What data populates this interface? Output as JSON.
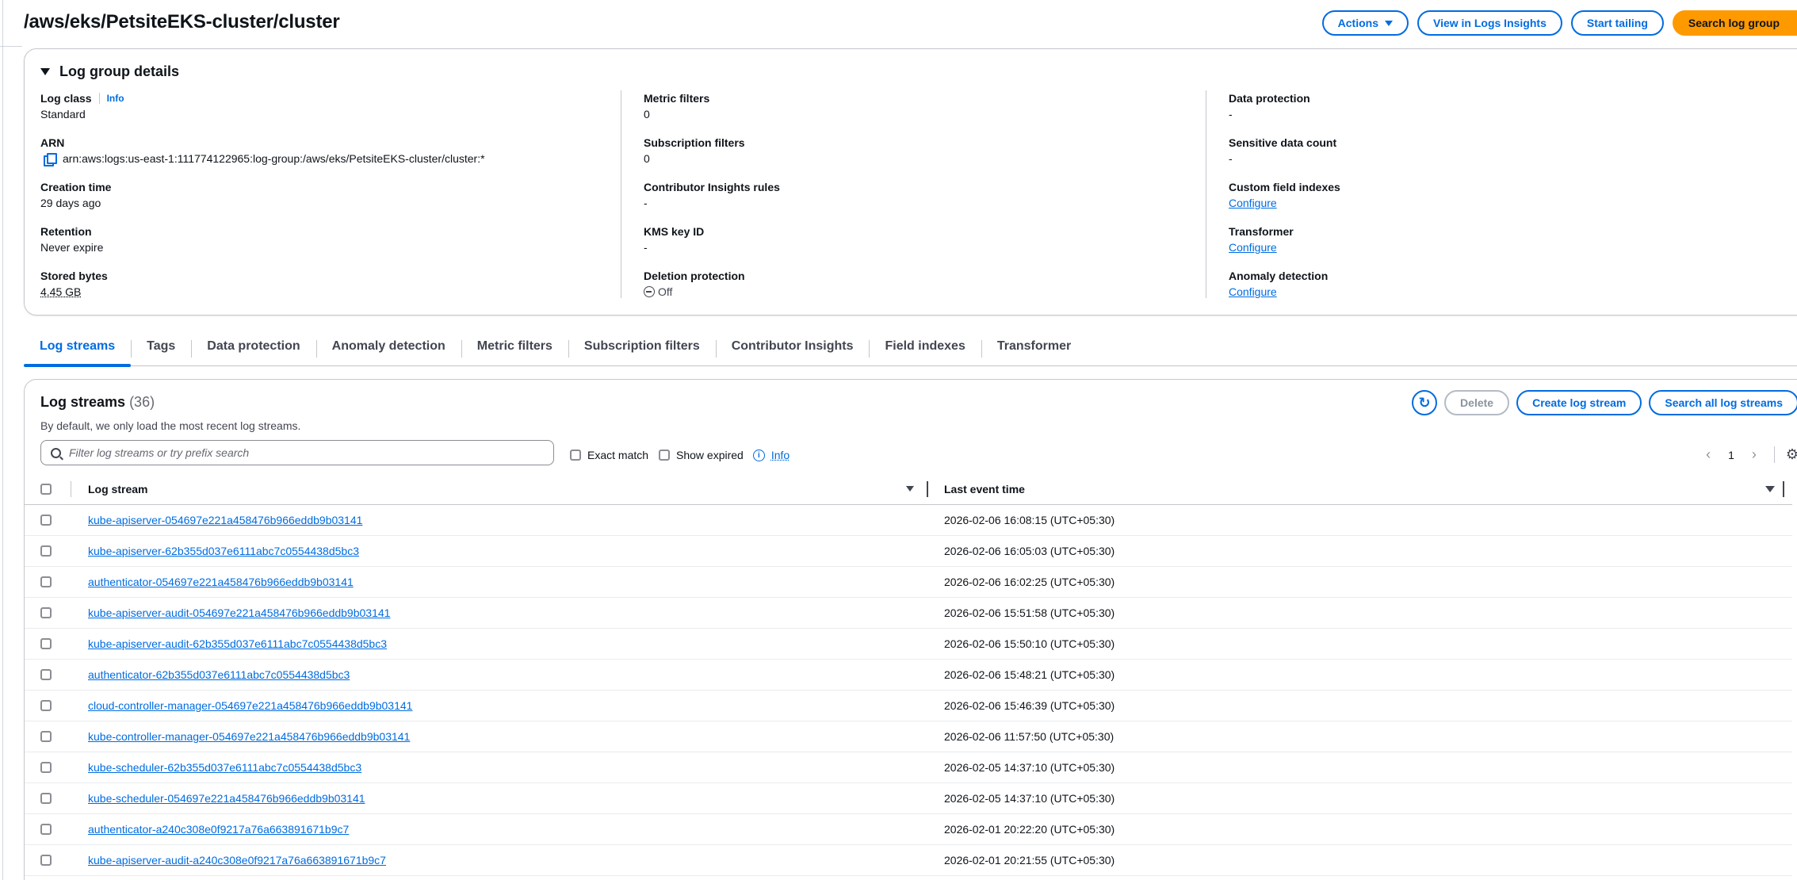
{
  "page": {
    "title": "/aws/eks/PetsiteEKS-cluster/cluster"
  },
  "header_actions": {
    "actions": "Actions",
    "view_insights": "View in Logs Insights",
    "start_tailing": "Start tailing",
    "search_log_group": "Search log group"
  },
  "details": {
    "title": "Log group details",
    "col1": [
      {
        "label": "Log class",
        "value": "Standard",
        "info": "Info"
      },
      {
        "label": "ARN",
        "value": "arn:aws:logs:us-east-1:111774122965:log-group:/aws/eks/PetsiteEKS-cluster/cluster:*"
      },
      {
        "label": "Creation time",
        "value": "29 days ago"
      },
      {
        "label": "Retention",
        "value": "Never expire"
      },
      {
        "label": "Stored bytes",
        "value": "4.45 GB"
      }
    ],
    "col2": [
      {
        "label": "Metric filters",
        "value": "0"
      },
      {
        "label": "Subscription filters",
        "value": "0"
      },
      {
        "label": "Contributor Insights rules",
        "value": "-"
      },
      {
        "label": "KMS key ID",
        "value": "-"
      },
      {
        "label": "Deletion protection",
        "value": "Off"
      }
    ],
    "col3": [
      {
        "label": "Data protection",
        "value": "-"
      },
      {
        "label": "Sensitive data count",
        "value": "-"
      },
      {
        "label": "Custom field indexes",
        "value": "Configure"
      },
      {
        "label": "Transformer",
        "value": "Configure"
      },
      {
        "label": "Anomaly detection",
        "value": "Configure"
      }
    ]
  },
  "tabs": [
    "Log streams",
    "Tags",
    "Data protection",
    "Anomaly detection",
    "Metric filters",
    "Subscription filters",
    "Contributor Insights",
    "Field indexes",
    "Transformer"
  ],
  "streams": {
    "title": "Log streams",
    "count": "(36)",
    "description": "By default, we only load the most recent log streams.",
    "delete": "Delete",
    "create": "Create log stream",
    "search_all": "Search all log streams",
    "filter_placeholder": "Filter log streams or try prefix search",
    "exact_match": "Exact match",
    "show_expired": "Show expired",
    "info": "Info",
    "page": "1",
    "col_stream": "Log stream",
    "col_time": "Last event time",
    "rows": [
      {
        "name": "kube-apiserver-054697e221a458476b966eddb9b03141",
        "time": "2026-02-06 16:08:15 (UTC+05:30)"
      },
      {
        "name": "kube-apiserver-62b355d037e6111abc7c0554438d5bc3",
        "time": "2026-02-06 16:05:03 (UTC+05:30)"
      },
      {
        "name": "authenticator-054697e221a458476b966eddb9b03141",
        "time": "2026-02-06 16:02:25 (UTC+05:30)"
      },
      {
        "name": "kube-apiserver-audit-054697e221a458476b966eddb9b03141",
        "time": "2026-02-06 15:51:58 (UTC+05:30)"
      },
      {
        "name": "kube-apiserver-audit-62b355d037e6111abc7c0554438d5bc3",
        "time": "2026-02-06 15:50:10 (UTC+05:30)"
      },
      {
        "name": "authenticator-62b355d037e6111abc7c0554438d5bc3",
        "time": "2026-02-06 15:48:21 (UTC+05:30)"
      },
      {
        "name": "cloud-controller-manager-054697e221a458476b966eddb9b03141",
        "time": "2026-02-06 15:46:39 (UTC+05:30)"
      },
      {
        "name": "kube-controller-manager-054697e221a458476b966eddb9b03141",
        "time": "2026-02-06 11:57:50 (UTC+05:30)"
      },
      {
        "name": "kube-scheduler-62b355d037e6111abc7c0554438d5bc3",
        "time": "2026-02-05 14:37:10 (UTC+05:30)"
      },
      {
        "name": "kube-scheduler-054697e221a458476b966eddb9b03141",
        "time": "2026-02-05 14:37:10 (UTC+05:30)"
      },
      {
        "name": "authenticator-a240c308e0f9217a76a663891671b9c7",
        "time": "2026-02-01 20:22:20 (UTC+05:30)"
      },
      {
        "name": "kube-apiserver-audit-a240c308e0f9217a76a663891671b9c7",
        "time": "2026-02-01 20:21:55 (UTC+05:30)"
      }
    ]
  },
  "colors": {
    "link": "#006ce0",
    "primary_button": "#ff9900",
    "border": "#c6c6cd"
  }
}
